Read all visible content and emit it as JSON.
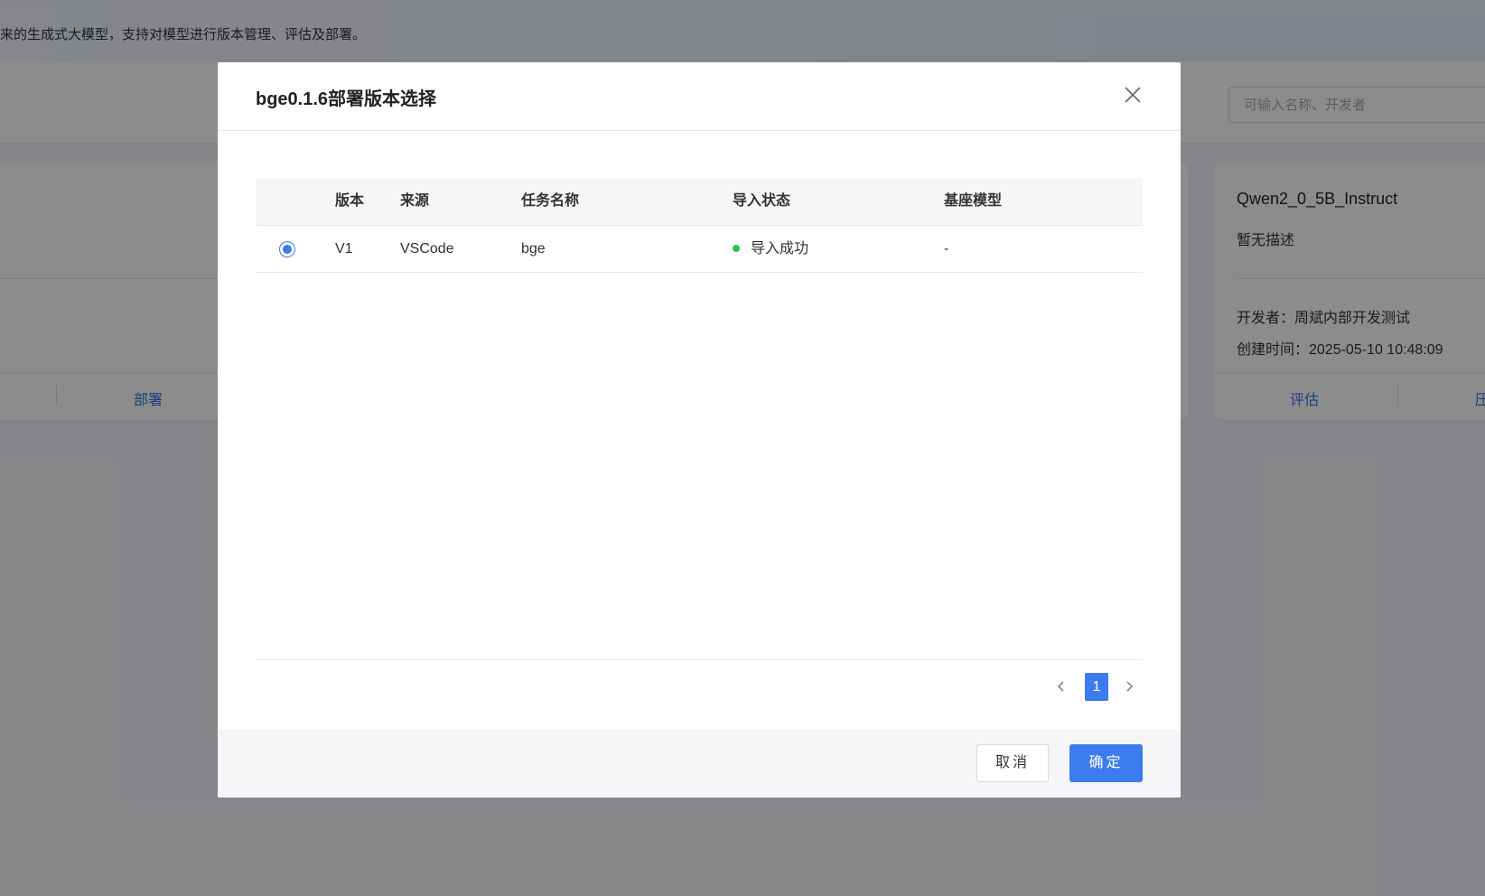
{
  "background": {
    "banner_text": "来的生成式大模型，支持对模型进行版本管理、评估及部署。",
    "search_placeholder": "可输入名称、开发者",
    "left_card": {
      "action": "部署"
    },
    "right_card": {
      "name": "Qwen2_0_5B_Instruct",
      "description": "暂无描述",
      "developer": "开发者：周斌内部开发测试",
      "created": "创建时间：2025-05-10 10:48:09",
      "action_evaluate": "评估",
      "action_partial": "压"
    }
  },
  "modal": {
    "title": "bge0.1.6部署版本选择",
    "table": {
      "headers": {
        "version": "版本",
        "source": "来源",
        "task": "任务名称",
        "status": "导入状态",
        "base": "基座模型"
      },
      "rows": [
        {
          "selected": true,
          "version": "V1",
          "source": "VSCode",
          "task": "bge",
          "status": "导入成功",
          "base": "-"
        }
      ]
    },
    "pagination": {
      "current": "1"
    },
    "cancel_label": "取消",
    "ok_label": "确定"
  },
  "colors": {
    "primary": "#3d7bf0",
    "success": "#2dbf5c",
    "overlay": "rgba(0,0,0,0.45)"
  },
  "icons": {
    "close": "close-icon",
    "prev": "chevron-left-icon",
    "next": "chevron-right-icon"
  }
}
